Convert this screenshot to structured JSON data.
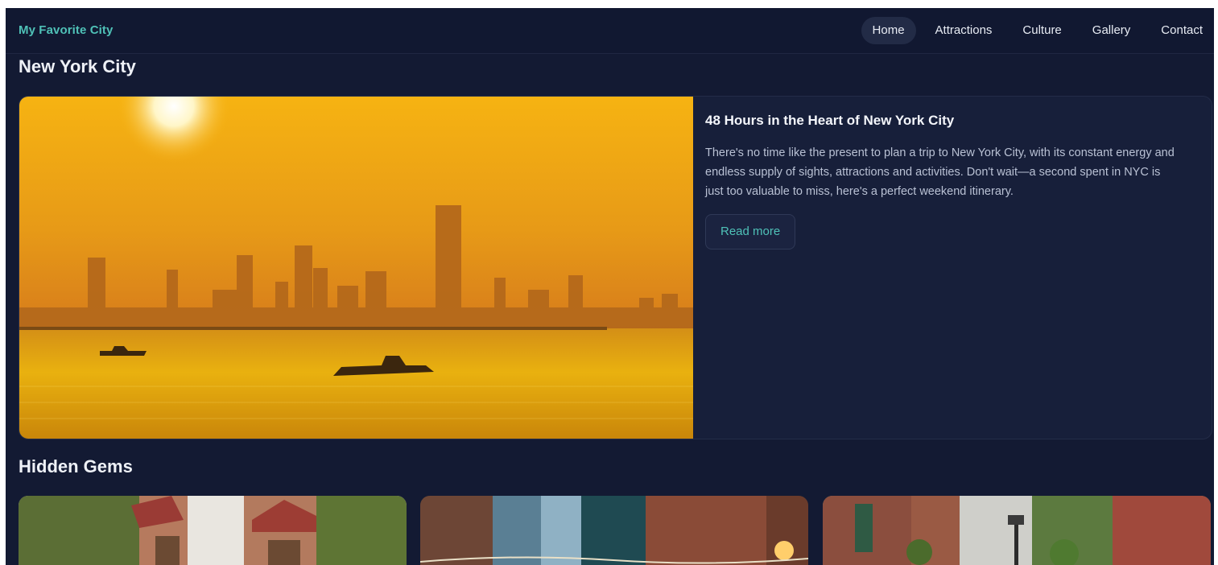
{
  "nav": {
    "brand": "My Favorite City",
    "links": [
      {
        "label": "Home",
        "active": true
      },
      {
        "label": "Attractions",
        "active": false
      },
      {
        "label": "Culture",
        "active": false
      },
      {
        "label": "Gallery",
        "active": false
      },
      {
        "label": "Contact",
        "active": false
      }
    ]
  },
  "city": {
    "title": "New York City"
  },
  "feature": {
    "title": "48 Hours in the Heart of New York City",
    "body": "There's no time like the present to plan a trip to New York City, with its constant energy and endless supply of sights, attractions and activities. Don't wait—a second spent in NYC is just too valuable to miss, here's a perfect weekend itinerary.",
    "cta": "Read more",
    "image_icon": "sunset-skyline-photo"
  },
  "hidden_gems": {
    "title": "Hidden Gems",
    "cards": [
      {
        "image_icon": "ivy-covered-street-photo"
      },
      {
        "image_icon": "city-alley-lights-photo"
      },
      {
        "image_icon": "garden-street-photo"
      }
    ]
  },
  "colors": {
    "accent": "#4fc1b7",
    "background": "#131a33",
    "card": "#171f3a"
  }
}
